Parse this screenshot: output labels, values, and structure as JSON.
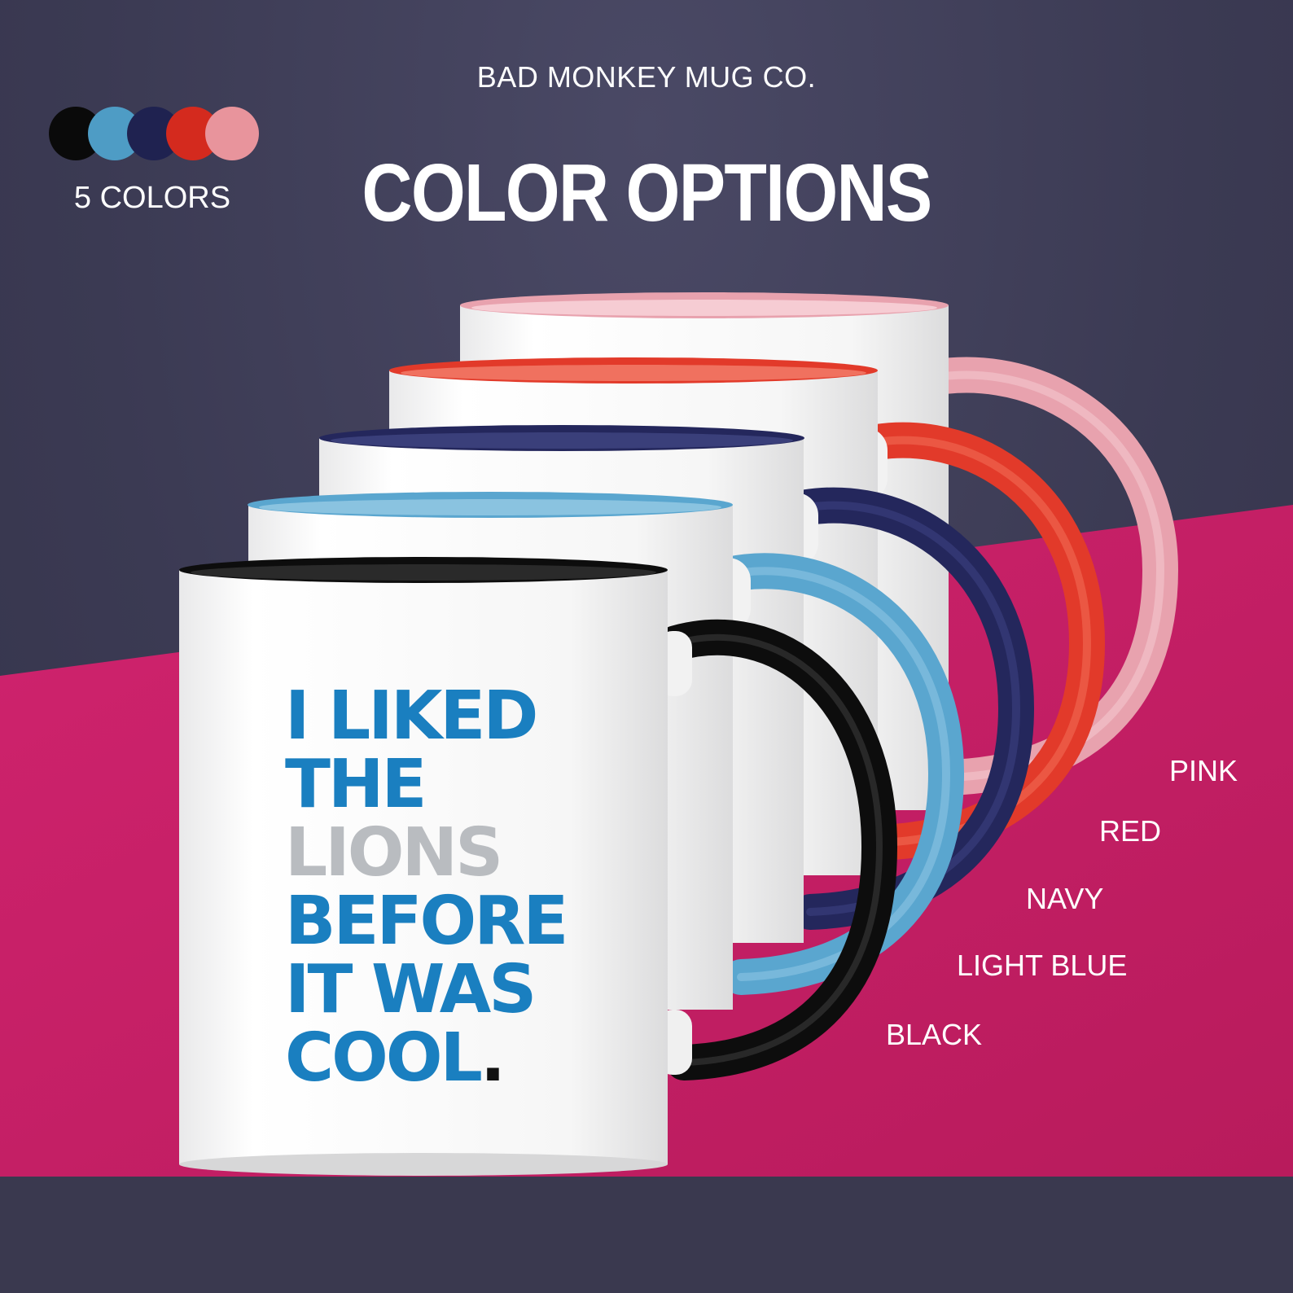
{
  "brand": "BAD MONKEY MUG CO.",
  "headline": "COLOR OPTIONS",
  "colors_count_label": "5 COLORS",
  "swatch_colors": [
    "#0a0a0a",
    "#4e9cc5",
    "#1f2250",
    "#d42a1e",
    "#e8949c"
  ],
  "background_color": "#3d3c55",
  "floor_color": "#c91f67",
  "mug": {
    "line1": "I LIKED",
    "line2": "THE",
    "line3": "LIONS",
    "line4": "BEFORE",
    "line5": "IT WAS",
    "line6": "COOL",
    "period": ".",
    "text_color": "#1a7fc0",
    "muted_color": "#b9bcc0"
  },
  "color_labels": {
    "pink": "PINK",
    "red": "RED",
    "navy": "NAVY",
    "light_blue": "LIGHT BLUE",
    "black": "BLACK"
  },
  "mug_colors": {
    "pink": "#e8a2ae",
    "red": "#e23a2a",
    "navy": "#24275c",
    "light_blue": "#5aa6cf",
    "black": "#0d0d0d"
  }
}
